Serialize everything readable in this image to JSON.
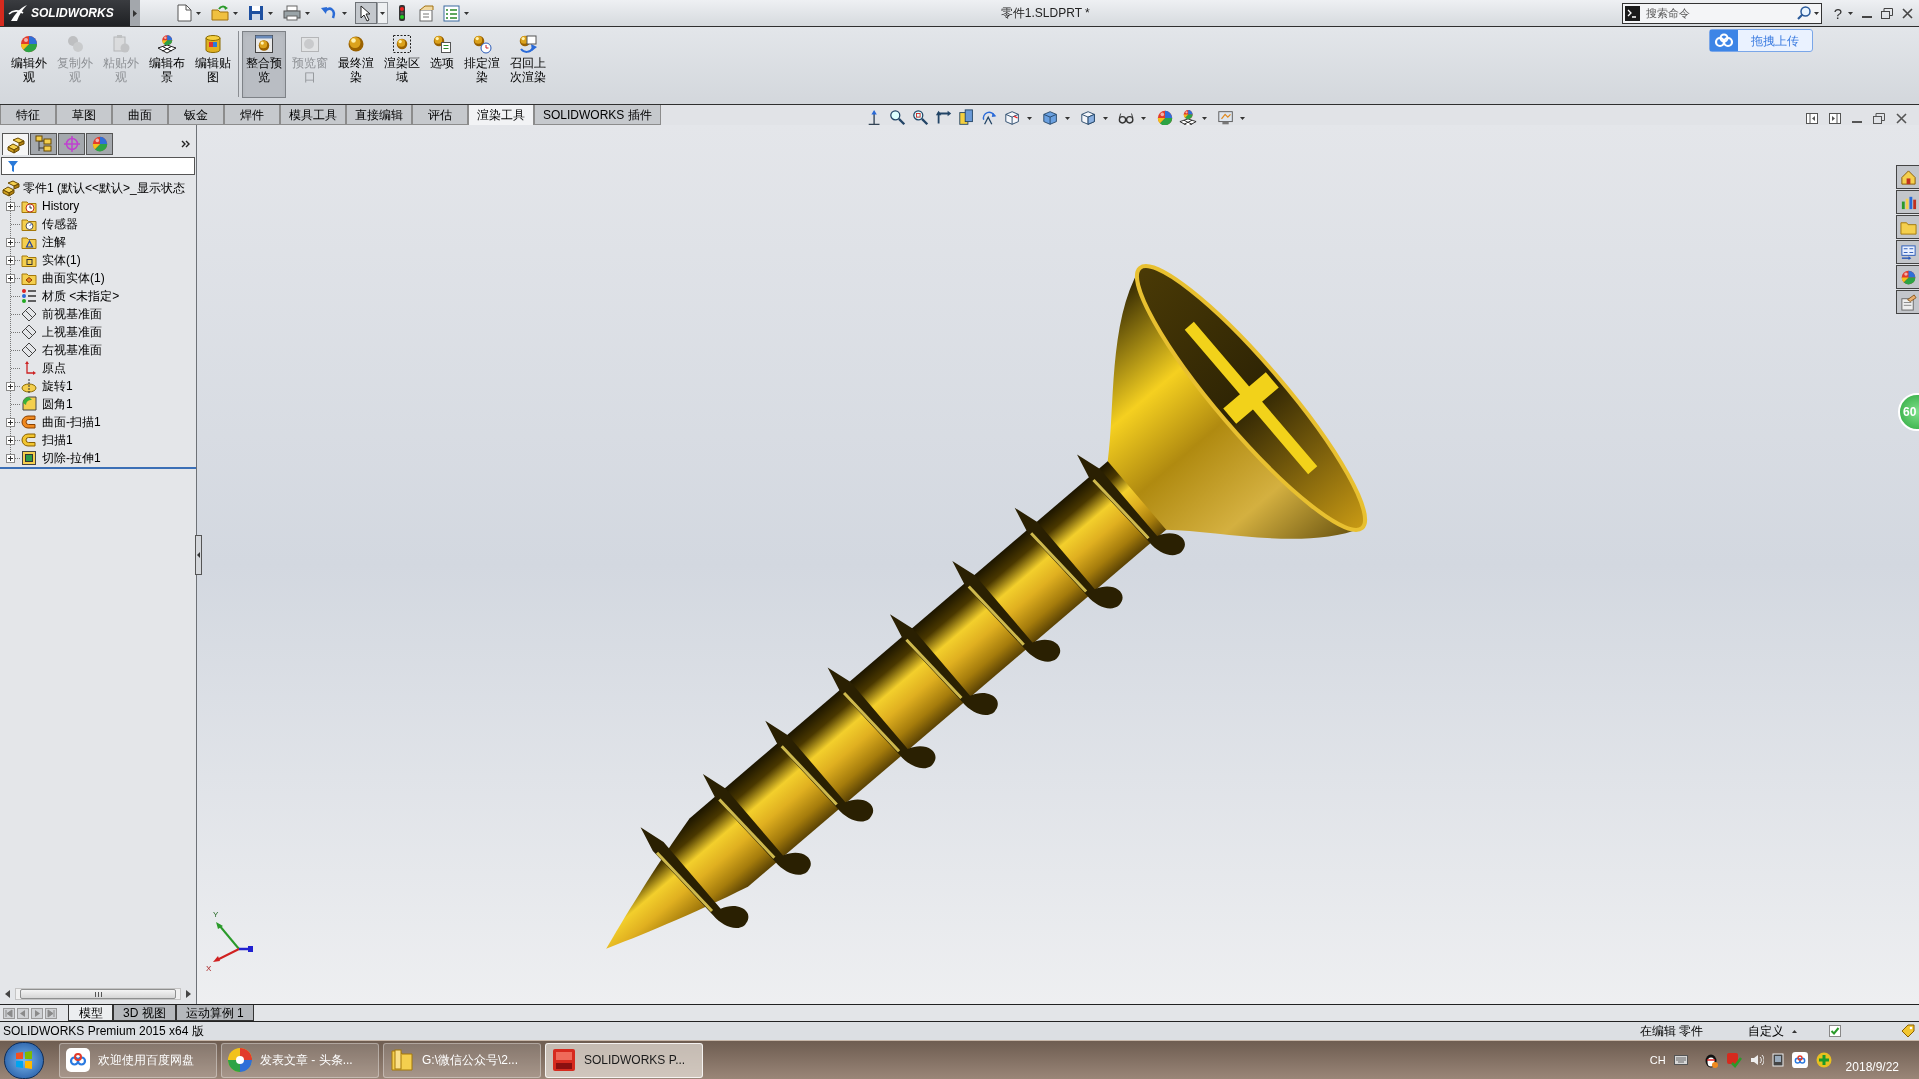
{
  "title_bar": {
    "logo": "SOLIDWORKS",
    "pointer_pressed": true,
    "document_title": "零件1.SLDPRT *",
    "search": {
      "placeholder": "搜索命令"
    },
    "help": "?"
  },
  "upload_widget": {
    "label": "拖拽上传"
  },
  "command_manager": {
    "buttons": [
      {
        "label": "编辑外观",
        "disabled": false,
        "selected": false
      },
      {
        "label": "复制外观",
        "disabled": true,
        "selected": false
      },
      {
        "label": "粘贴外观",
        "disabled": true,
        "selected": false
      },
      {
        "label": "编辑布景",
        "disabled": false,
        "selected": false
      },
      {
        "label": "编辑贴图",
        "disabled": false,
        "selected": false
      },
      {
        "label": "整合预览",
        "disabled": false,
        "selected": true
      },
      {
        "label": "预览窗口",
        "disabled": true,
        "selected": false
      },
      {
        "label": "最终渲染",
        "disabled": false,
        "selected": false
      },
      {
        "label": "渲染区域",
        "disabled": false,
        "selected": false
      },
      {
        "label": "选项",
        "disabled": false,
        "selected": false
      },
      {
        "label": "排定渲染",
        "disabled": false,
        "selected": false
      },
      {
        "label": "召回上次渲染",
        "disabled": false,
        "selected": false
      }
    ]
  },
  "tabs": [
    {
      "label": "特征",
      "selected": false
    },
    {
      "label": "草图",
      "selected": false
    },
    {
      "label": "曲面",
      "selected": false
    },
    {
      "label": "钣金",
      "selected": false
    },
    {
      "label": "焊件",
      "selected": false
    },
    {
      "label": "模具工具",
      "selected": false
    },
    {
      "label": "直接编辑",
      "selected": false
    },
    {
      "label": "评估",
      "selected": false
    },
    {
      "label": "渲染工具",
      "selected": true
    },
    {
      "label": "SOLIDWORKS 插件",
      "selected": false
    }
  ],
  "feature_manager": {
    "tabs": [
      {
        "selected": true
      },
      {
        "selected": false
      },
      {
        "selected": false
      },
      {
        "selected": false
      }
    ],
    "tree": {
      "label": "零件1 (默认<<默认>_显示状态",
      "children": [
        {
          "label": "History",
          "expandable": true
        },
        {
          "label": "传感器",
          "expandable": false
        },
        {
          "label": "注解",
          "expandable": true
        },
        {
          "label": "实体(1)",
          "expandable": true
        },
        {
          "label": "曲面实体(1)",
          "expandable": true
        },
        {
          "label": "材质 <未指定>",
          "expandable": false
        },
        {
          "label": "前视基准面",
          "expandable": false
        },
        {
          "label": "上视基准面",
          "expandable": false
        },
        {
          "label": "右视基准面",
          "expandable": false
        },
        {
          "label": "原点",
          "expandable": false
        },
        {
          "label": "旋转1",
          "expandable": true
        },
        {
          "label": "圆角1",
          "expandable": false
        },
        {
          "label": "曲面-扫描1",
          "expandable": true
        },
        {
          "label": "扫描1",
          "expandable": true
        },
        {
          "label": "切除-拉伸1",
          "expandable": true
        }
      ]
    }
  },
  "viewport": {
    "triad": {
      "y_label": "Y",
      "x_label": "X"
    },
    "badge": "60"
  },
  "bottom_tabs": [
    {
      "label": "模型",
      "selected": true
    },
    {
      "label": "3D 视图",
      "selected": false
    },
    {
      "label": "运动算例 1",
      "selected": false
    }
  ],
  "status_bar": {
    "product": "SOLIDWORKS Premium 2015 x64 版",
    "mode": "在编辑 零件",
    "units": "自定义"
  },
  "taskbar": {
    "tasks": [
      {
        "label": "欢迎使用百度网盘",
        "selected": false
      },
      {
        "label": "发表文章 - 头条...",
        "selected": false
      },
      {
        "label": "G:\\微信公众号\\2...",
        "selected": false
      },
      {
        "label": "SOLIDWORKS P...",
        "selected": true
      }
    ],
    "language": "CH",
    "date": "2018/9/22"
  }
}
